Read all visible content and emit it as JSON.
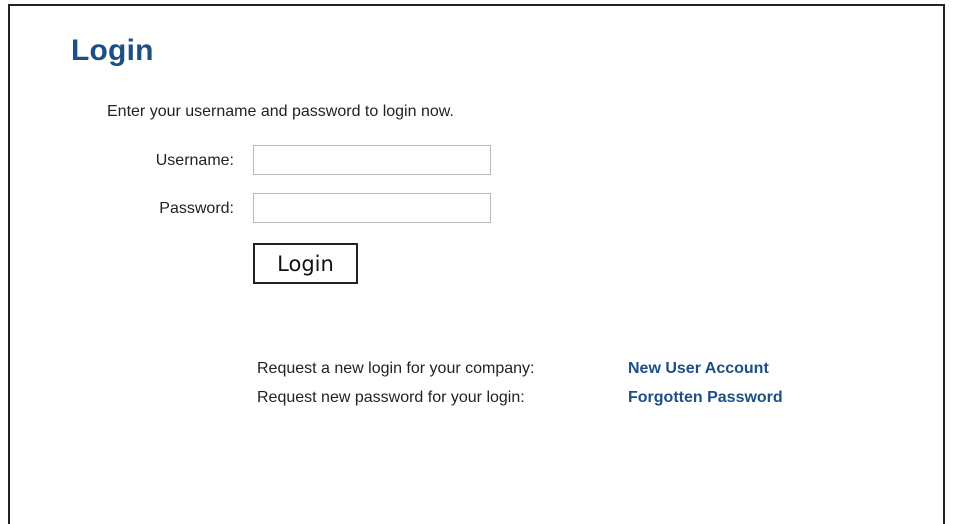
{
  "page": {
    "title": "Login",
    "intro": "Enter your username and password to login now."
  },
  "form": {
    "username_label": "Username:",
    "username_value": "",
    "password_label": "Password:",
    "password_value": "",
    "submit_label": "Login"
  },
  "links": {
    "new_account_desc": "Request a new login for your company:",
    "new_account_label": "New User Account",
    "forgot_desc": "Request new password for your login:",
    "forgot_label": "Forgotten Password"
  },
  "colors": {
    "heading": "#1d4f86",
    "link": "#1d4f86"
  }
}
